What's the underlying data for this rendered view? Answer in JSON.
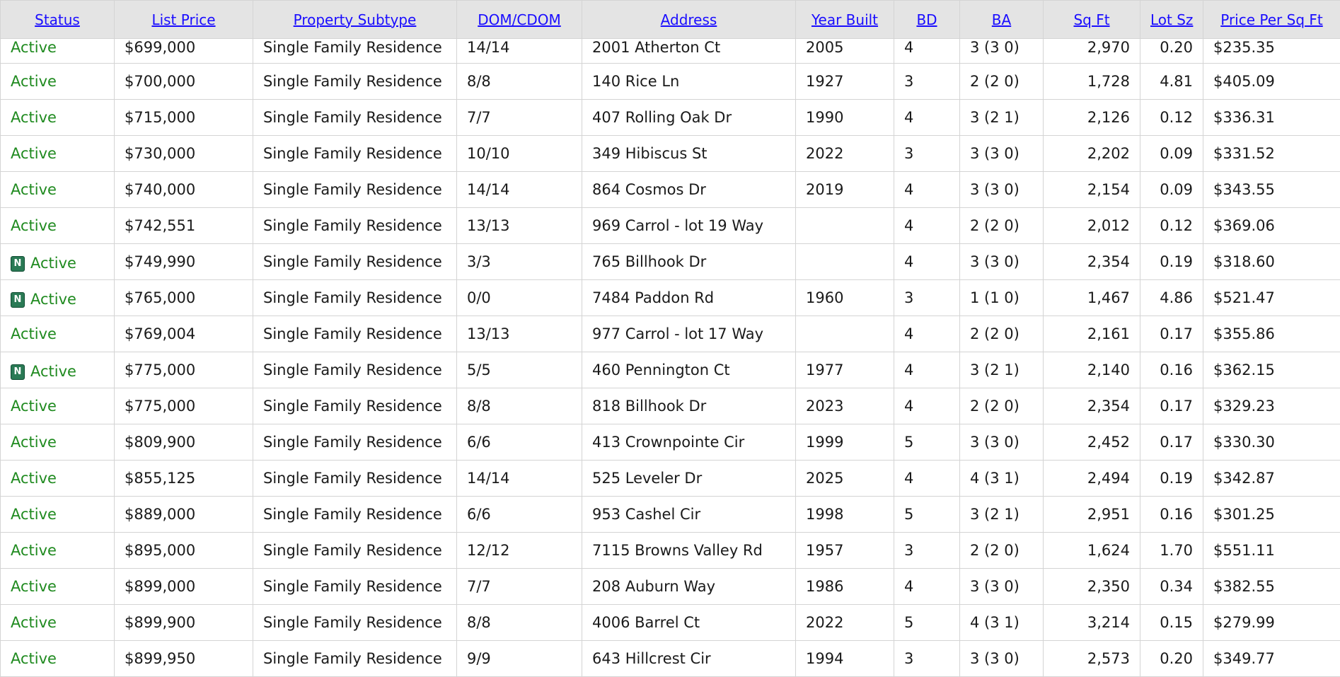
{
  "columns": [
    {
      "key": "status",
      "label": "Status"
    },
    {
      "key": "list_price",
      "label": "List Price"
    },
    {
      "key": "property_subtype",
      "label": "Property Subtype"
    },
    {
      "key": "dom_cdom",
      "label": "DOM/CDOM"
    },
    {
      "key": "address",
      "label": "Address"
    },
    {
      "key": "year_built",
      "label": "Year Built"
    },
    {
      "key": "bd",
      "label": "BD"
    },
    {
      "key": "ba",
      "label": "BA"
    },
    {
      "key": "sq_ft",
      "label": "Sq Ft"
    },
    {
      "key": "lot_sz",
      "label": "Lot Sz"
    },
    {
      "key": "price_per_sq_ft",
      "label": "Price Per Sq Ft"
    }
  ],
  "new_badge": {
    "label": "N",
    "color": "#2a7a55"
  },
  "status_color": "#1f8a1f",
  "link_color": "#1a0dff",
  "rows": [
    {
      "is_new": false,
      "status": "Active",
      "list_price": "$699,000",
      "property_subtype": "Single Family Residence",
      "dom_cdom": "14/14",
      "address": "2001 Atherton Ct",
      "year_built": "2005",
      "bd": "4",
      "ba": "3 (3 0)",
      "sq_ft": "2,970",
      "lot_sz": "0.20",
      "price_per_sq_ft": "$235.35"
    },
    {
      "is_new": false,
      "status": "Active",
      "list_price": "$700,000",
      "property_subtype": "Single Family Residence",
      "dom_cdom": "8/8",
      "address": "140 Rice Ln",
      "year_built": "1927",
      "bd": "3",
      "ba": "2 (2 0)",
      "sq_ft": "1,728",
      "lot_sz": "4.81",
      "price_per_sq_ft": "$405.09"
    },
    {
      "is_new": false,
      "status": "Active",
      "list_price": "$715,000",
      "property_subtype": "Single Family Residence",
      "dom_cdom": "7/7",
      "address": "407 Rolling Oak Dr",
      "year_built": "1990",
      "bd": "4",
      "ba": "3 (2 1)",
      "sq_ft": "2,126",
      "lot_sz": "0.12",
      "price_per_sq_ft": "$336.31"
    },
    {
      "is_new": false,
      "status": "Active",
      "list_price": "$730,000",
      "property_subtype": "Single Family Residence",
      "dom_cdom": "10/10",
      "address": "349 Hibiscus St",
      "year_built": "2022",
      "bd": "3",
      "ba": "3 (3 0)",
      "sq_ft": "2,202",
      "lot_sz": "0.09",
      "price_per_sq_ft": "$331.52"
    },
    {
      "is_new": false,
      "status": "Active",
      "list_price": "$740,000",
      "property_subtype": "Single Family Residence",
      "dom_cdom": "14/14",
      "address": "864 Cosmos Dr",
      "year_built": "2019",
      "bd": "4",
      "ba": "3 (3 0)",
      "sq_ft": "2,154",
      "lot_sz": "0.09",
      "price_per_sq_ft": "$343.55"
    },
    {
      "is_new": false,
      "status": "Active",
      "list_price": "$742,551",
      "property_subtype": "Single Family Residence",
      "dom_cdom": "13/13",
      "address": "969 Carrol - lot 19 Way",
      "year_built": "",
      "bd": "4",
      "ba": "2 (2 0)",
      "sq_ft": "2,012",
      "lot_sz": "0.12",
      "price_per_sq_ft": "$369.06"
    },
    {
      "is_new": true,
      "status": "Active",
      "list_price": "$749,990",
      "property_subtype": "Single Family Residence",
      "dom_cdom": "3/3",
      "address": "765 Billhook Dr",
      "year_built": "",
      "bd": "4",
      "ba": "3 (3 0)",
      "sq_ft": "2,354",
      "lot_sz": "0.19",
      "price_per_sq_ft": "$318.60"
    },
    {
      "is_new": true,
      "status": "Active",
      "list_price": "$765,000",
      "property_subtype": "Single Family Residence",
      "dom_cdom": "0/0",
      "address": "7484 Paddon Rd",
      "year_built": "1960",
      "bd": "3",
      "ba": "1 (1 0)",
      "sq_ft": "1,467",
      "lot_sz": "4.86",
      "price_per_sq_ft": "$521.47"
    },
    {
      "is_new": false,
      "status": "Active",
      "list_price": "$769,004",
      "property_subtype": "Single Family Residence",
      "dom_cdom": "13/13",
      "address": "977 Carrol - lot 17 Way",
      "year_built": "",
      "bd": "4",
      "ba": "2 (2 0)",
      "sq_ft": "2,161",
      "lot_sz": "0.17",
      "price_per_sq_ft": "$355.86"
    },
    {
      "is_new": true,
      "status": "Active",
      "list_price": "$775,000",
      "property_subtype": "Single Family Residence",
      "dom_cdom": "5/5",
      "address": "460 Pennington Ct",
      "year_built": "1977",
      "bd": "4",
      "ba": "3 (2 1)",
      "sq_ft": "2,140",
      "lot_sz": "0.16",
      "price_per_sq_ft": "$362.15"
    },
    {
      "is_new": false,
      "status": "Active",
      "list_price": "$775,000",
      "property_subtype": "Single Family Residence",
      "dom_cdom": "8/8",
      "address": "818 Billhook Dr",
      "year_built": "2023",
      "bd": "4",
      "ba": "2 (2 0)",
      "sq_ft": "2,354",
      "lot_sz": "0.17",
      "price_per_sq_ft": "$329.23"
    },
    {
      "is_new": false,
      "status": "Active",
      "list_price": "$809,900",
      "property_subtype": "Single Family Residence",
      "dom_cdom": "6/6",
      "address": "413 Crownpointe Cir",
      "year_built": "1999",
      "bd": "5",
      "ba": "3 (3 0)",
      "sq_ft": "2,452",
      "lot_sz": "0.17",
      "price_per_sq_ft": "$330.30"
    },
    {
      "is_new": false,
      "status": "Active",
      "list_price": "$855,125",
      "property_subtype": "Single Family Residence",
      "dom_cdom": "14/14",
      "address": "525 Leveler Dr",
      "year_built": "2025",
      "bd": "4",
      "ba": "4 (3 1)",
      "sq_ft": "2,494",
      "lot_sz": "0.19",
      "price_per_sq_ft": "$342.87"
    },
    {
      "is_new": false,
      "status": "Active",
      "list_price": "$889,000",
      "property_subtype": "Single Family Residence",
      "dom_cdom": "6/6",
      "address": "953 Cashel Cir",
      "year_built": "1998",
      "bd": "5",
      "ba": "3 (2 1)",
      "sq_ft": "2,951",
      "lot_sz": "0.16",
      "price_per_sq_ft": "$301.25"
    },
    {
      "is_new": false,
      "status": "Active",
      "list_price": "$895,000",
      "property_subtype": "Single Family Residence",
      "dom_cdom": "12/12",
      "address": "7115 Browns Valley Rd",
      "year_built": "1957",
      "bd": "3",
      "ba": "2 (2 0)",
      "sq_ft": "1,624",
      "lot_sz": "1.70",
      "price_per_sq_ft": "$551.11"
    },
    {
      "is_new": false,
      "status": "Active",
      "list_price": "$899,000",
      "property_subtype": "Single Family Residence",
      "dom_cdom": "7/7",
      "address": "208 Auburn Way",
      "year_built": "1986",
      "bd": "4",
      "ba": "3 (3 0)",
      "sq_ft": "2,350",
      "lot_sz": "0.34",
      "price_per_sq_ft": "$382.55"
    },
    {
      "is_new": false,
      "status": "Active",
      "list_price": "$899,900",
      "property_subtype": "Single Family Residence",
      "dom_cdom": "8/8",
      "address": "4006 Barrel Ct",
      "year_built": "2022",
      "bd": "5",
      "ba": "4 (3 1)",
      "sq_ft": "3,214",
      "lot_sz": "0.15",
      "price_per_sq_ft": "$279.99"
    },
    {
      "is_new": false,
      "status": "Active",
      "list_price": "$899,950",
      "property_subtype": "Single Family Residence",
      "dom_cdom": "9/9",
      "address": "643 Hillcrest Cir",
      "year_built": "1994",
      "bd": "3",
      "ba": "3 (3 0)",
      "sq_ft": "2,573",
      "lot_sz": "0.20",
      "price_per_sq_ft": "$349.77"
    }
  ]
}
